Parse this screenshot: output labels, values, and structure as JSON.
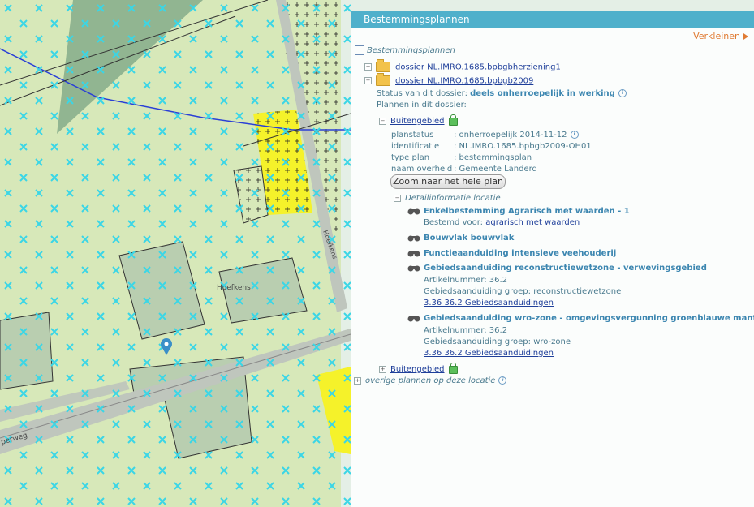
{
  "panel": {
    "title": "Bestemmingsplannen",
    "collapse_label": "Verkleinen",
    "root_label": "Bestemmingsplannen",
    "dossier1": "dossier NL.IMRO.1685.bpbgbherziening1",
    "dossier2": "dossier NL.IMRO.1685.bpbgb2009",
    "status_label": "Status van dit dossier:",
    "status_value": "deels onherroepelijk in werking",
    "plans_label": "Plannen in dit dossier:",
    "plan1": "Buitengebied",
    "details": [
      {
        "key": "planstatus",
        "value": ": onherroepelijk 2014-11-12"
      },
      {
        "key": "identificatie",
        "value": ": NL.IMRO.1685.bpbgb2009-OH01"
      },
      {
        "key": "type plan",
        "value": ": bestemmingsplan"
      },
      {
        "key": "naam overheid",
        "value": ": Gemeente Landerd"
      }
    ],
    "zoom_button": "Zoom naar het hele plan",
    "detail_header": "Detailinformatie locatie",
    "items": {
      "i1_title": "Enkelbestemming Agrarisch met waarden - 1",
      "i1_sub_label": "Bestemd voor:",
      "i1_sub_link": "agrarisch met waarden",
      "i2_title": "Bouwvlak bouwvlak",
      "i3_title": "Functieaanduiding intensieve veehouderij",
      "i4_title": "Gebiedsaanduiding reconstructiewetzone - verwevingsgebied",
      "i4_art": "Artikelnummer: 36.2",
      "i4_group": "Gebiedsaanduiding groep: reconstructiewetzone",
      "i4_link": "3.36   36.2  Gebiedsaanduidingen",
      "i5_title": "Gebiedsaanduiding wro-zone - omgevingsvergunning groenblauwe mantel",
      "i5_art": "Artikelnummer: 36.2",
      "i5_group": "Gebiedsaanduiding groep: wro-zone",
      "i5_link": "3.36   36.2  Gebiedsaanduidingen"
    },
    "plan2": "Buitengebied",
    "other_plans": "overige plannen op deze locatie"
  },
  "map": {
    "label_hoefkens": "Hoefkens",
    "label_road_vertical": "Hoefkens",
    "label_road_bottom": "perweg"
  },
  "colors": {
    "header": "#4fb0cb",
    "link": "#1f3f9a",
    "agrarisch": "#d7e8b9",
    "yellow": "#f5f22a",
    "cross": "#3ad6e6"
  }
}
